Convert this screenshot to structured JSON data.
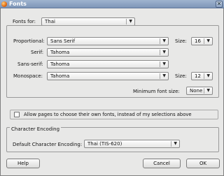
{
  "window": {
    "title": "Fonts",
    "close_glyph": "✕"
  },
  "fonts_for": {
    "label": "Fonts for:",
    "value": "Thai"
  },
  "proportional": {
    "label": "Proportional:",
    "value": "Sans Serif"
  },
  "size": {
    "label": "Size:",
    "value": "16"
  },
  "serif": {
    "label": "Serif:",
    "value": "Tahoma"
  },
  "sans_serif": {
    "label": "Sans-serif:",
    "value": "Tahoma"
  },
  "monospace": {
    "label": "Monospace:",
    "value": "Tahoma",
    "size_label": "Size:",
    "size_value": "12"
  },
  "minimum_font_size": {
    "label": "Minimum font size:",
    "value": "None"
  },
  "allow_pages": {
    "label": "Allow pages to choose their own fonts, instead of my selections above",
    "checked": false
  },
  "encoding": {
    "section_title": "Character Encoding",
    "label": "Default Character Encoding:",
    "value": "Thai (TIS-620)"
  },
  "buttons": {
    "help": "Help",
    "cancel": "Cancel",
    "ok": "OK"
  },
  "colors": {
    "title_bar": "#8ba2c2",
    "dialog_bg": "#e8e8e7",
    "accent": "#e36a12"
  }
}
